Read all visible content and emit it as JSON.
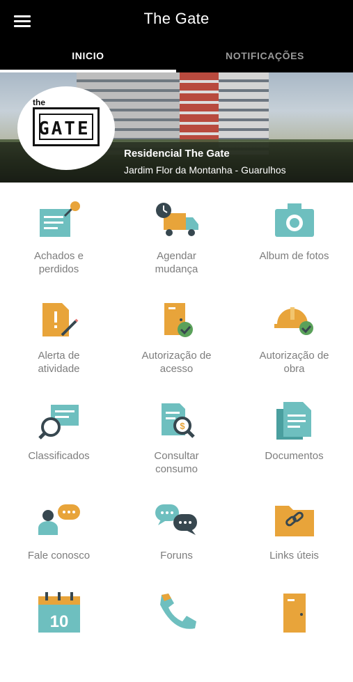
{
  "header": {
    "title": "The Gate",
    "menu_icon": "hamburger-menu-icon"
  },
  "tabs": [
    {
      "label": "INICIO",
      "active": true
    },
    {
      "label": "NOTIFICAÇÕES",
      "active": false
    }
  ],
  "banner": {
    "logo_small": "the",
    "logo_big": "GATE",
    "residence_name": "Residencial The Gate",
    "location": "Jardim Flor da Montanha - Guarulhos"
  },
  "colors": {
    "teal": "#6ebfbf",
    "orange": "#e8a43a",
    "navy": "#37474f",
    "green": "#5aa15a"
  },
  "tiles": [
    {
      "label": "Achados e\nperdidos",
      "icon": "lost-and-found-icon"
    },
    {
      "label": "Agendar\nmudança",
      "icon": "moving-truck-icon"
    },
    {
      "label": "Album de fotos",
      "icon": "camera-icon"
    },
    {
      "label": "Alerta de\natividade",
      "icon": "activity-alert-icon"
    },
    {
      "label": "Autorização de\nacesso",
      "icon": "access-door-icon"
    },
    {
      "label": "Autorização de\nobra",
      "icon": "hard-hat-icon"
    },
    {
      "label": "Classificados",
      "icon": "classifieds-icon"
    },
    {
      "label": "Consultar\nconsumo",
      "icon": "consumption-icon"
    },
    {
      "label": "Documentos",
      "icon": "documents-icon"
    },
    {
      "label": "Fale conosco",
      "icon": "contact-us-icon"
    },
    {
      "label": "Foruns",
      "icon": "forums-icon"
    },
    {
      "label": "Links úteis",
      "icon": "links-folder-icon"
    },
    {
      "label": "",
      "icon": "calendar-icon",
      "calendar_day": "10"
    },
    {
      "label": "",
      "icon": "phone-icon"
    },
    {
      "label": "",
      "icon": "door-icon"
    }
  ]
}
